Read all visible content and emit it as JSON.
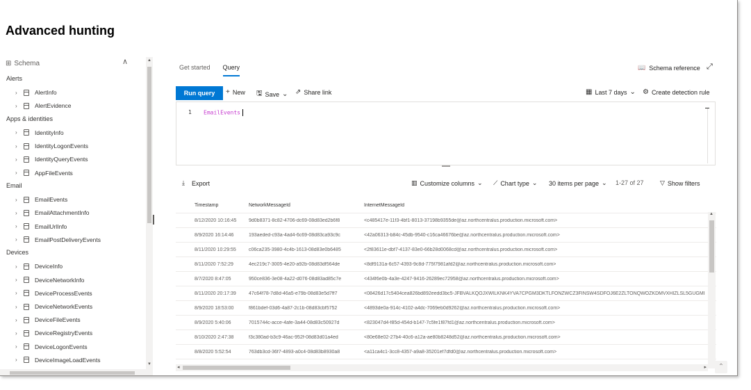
{
  "page": {
    "title": "Advanced hunting"
  },
  "schema": {
    "header": "Schema",
    "groups": [
      {
        "label": "Alerts",
        "items": [
          "AlertInfo",
          "AlertEvidence"
        ]
      },
      {
        "label": "Apps & identities",
        "items": [
          "IdentityInfo",
          "IdentityLogonEvents",
          "IdentityQueryEvents",
          "AppFileEvents"
        ]
      },
      {
        "label": "Email",
        "items": [
          "EmailEvents",
          "EmailAttachmentInfo",
          "EmailUrlInfo",
          "EmailPostDeliveryEvents"
        ]
      },
      {
        "label": "Devices",
        "items": [
          "DeviceInfo",
          "DeviceNetworkInfo",
          "DeviceProcessEvents",
          "DeviceNetworkEvents",
          "DeviceFileEvents",
          "DeviceRegistryEvents",
          "DeviceLogonEvents",
          "DeviceImageLoadEvents"
        ]
      }
    ]
  },
  "tabs": {
    "get_started": "Get started",
    "query": "Query"
  },
  "schema_reference": "Schema reference",
  "toolbar": {
    "run_query": "Run query",
    "new": "New",
    "save": "Save",
    "share_link": "Share link",
    "time_range": "Last 7 days",
    "create_rule": "Create detection rule"
  },
  "editor": {
    "line_number": "1",
    "query": "EmailEvents"
  },
  "results": {
    "export": "Export",
    "customize_columns": "Customize columns",
    "chart_type": "Chart type",
    "items_per_page": "30 items per page",
    "range": "1-27 of 27",
    "show_filters": "Show filters"
  },
  "grid": {
    "columns": [
      "Timestamp",
      "NetworkMessageId",
      "InternetMessageId"
    ],
    "rows": [
      [
        "8/12/2020 10:16:45",
        "9d0b8371-8c82-4706-dc69-08d83ed2b6f8",
        "<c485417e-11f3-4bf1-8013-37198b9355de@az.northcentralus.production.microsoft.com>"
      ],
      [
        "8/9/2020 16:14:46",
        "193aeded-c93a-4ad4-6c69-08d83ca93c9c",
        "<42a06313-b84c-45db-9540-c16ca46676be@az.northcentralus.production.microsoft.com>"
      ],
      [
        "8/11/2020 10:29:55",
        "c06ca235-3980-4c4b-1613-08d83e0b6485",
        "<2f83611e-dbf7-4137-83e0-66b28d0068cd@az.northcentralus.production.microsoft.com>"
      ],
      [
        "8/11/2020 7:52:29",
        "4ec219c7-3005-4e20-a92b-08d83df564de",
        "<8df9131a-6c57-4393-9c8d-775f7981afd2@az.northcentralus.production.microsoft.com>"
      ],
      [
        "8/7/2020 8:47:05",
        "950ce836-3e08-4a22-d076-08d83ad85c7e",
        "<434f6e0b-4a3e-4247-9416-26289ec72958@az.northcentralus.production.microsoft.com>"
      ],
      [
        "8/11/2020 20:17:39",
        "47c64f78-7d8d-46a5-e79b-08d83e5d7ff7",
        "<08426d17c5404cea826bd892eedd3bc5-JFBVALKQOJXWILKNK4YVA7CPGM3DKTLFONZWCZ3FINSW4SDFOJ6E2ZLTONQWOZKDMVXHIZLSL5GUGMI"
      ],
      [
        "8/9/2020 18:53:00",
        "f861bdef-03d6-4a87-2c1b-08d83cbf5752",
        "<4893de0a-914c-4102-a4dc-7069eb0d9262@az.northcentralus.production.microsoft.com>"
      ],
      [
        "8/9/2020 5:40:06",
        "7015744c-acce-4afe-3a44-08d83c50927d",
        "<823047d4-f85d-454d-b147-7c5fe1f87fd1@az.northcentralus.production.microsoft.com>"
      ],
      [
        "8/10/2020 2:47:38",
        "f3c380ad-b3c9-46ac-952f-08d83d01a4ed",
        "<80e68e02-27b4-40c6-a12a-ae80b8248d52@az.northcentralus.production.microsoft.com>"
      ],
      [
        "8/8/2020 5:52:54",
        "763db3cd-36f7-4893-a0c4-08d83b8930a8",
        "<a11ca4c1-3cc8-4357-a9a8-35201ef7dfd0@az.northcentralus.production.microsoft.com>"
      ]
    ]
  },
  "colors": {
    "accent": "#0078d4",
    "query_keyword": "#c63bcf"
  }
}
